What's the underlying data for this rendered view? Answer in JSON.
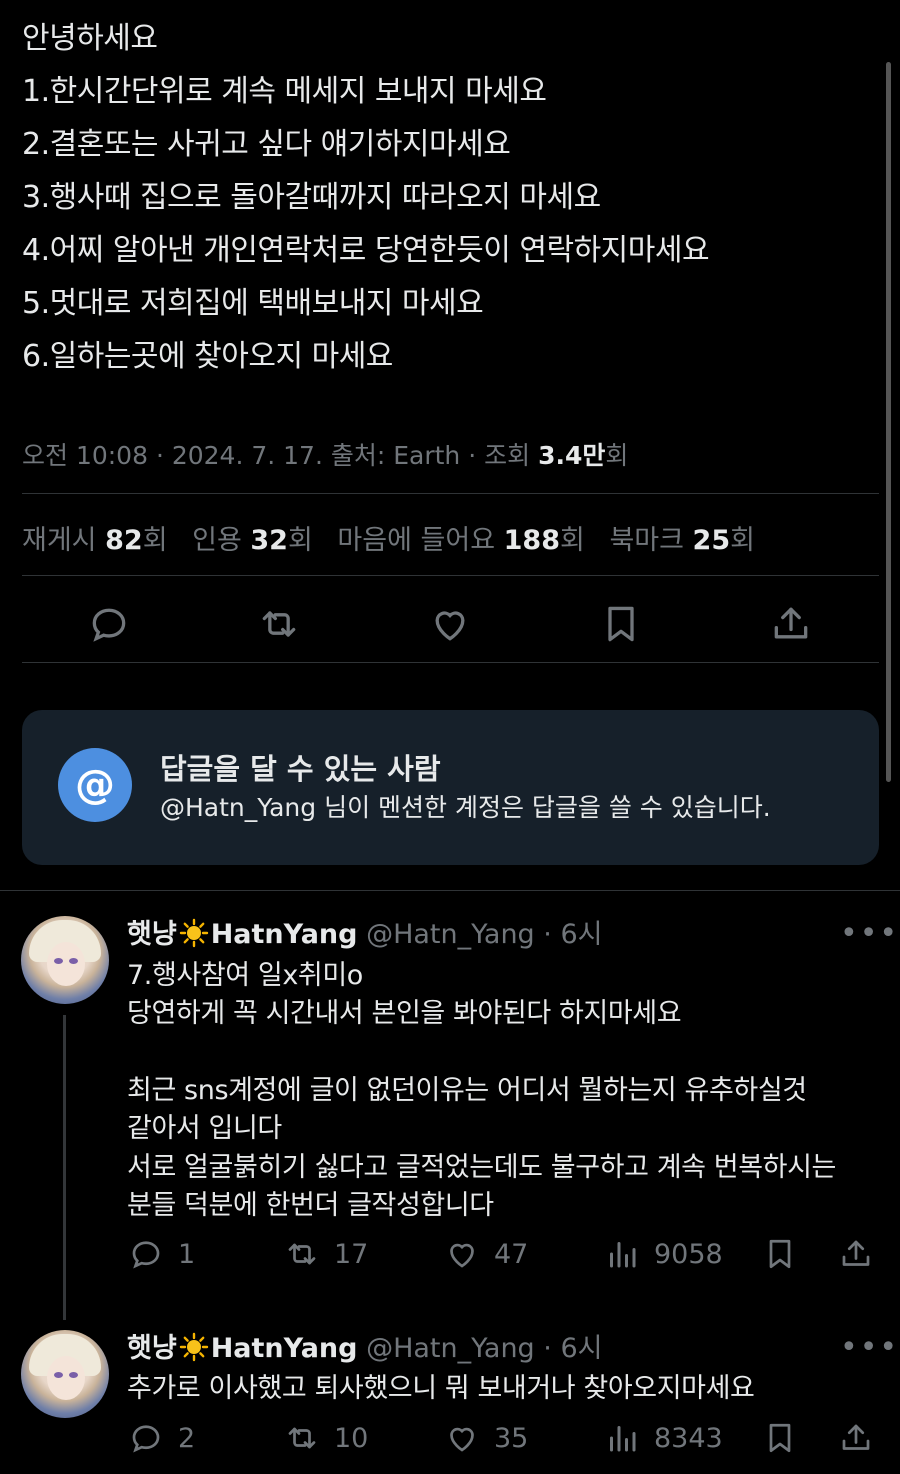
{
  "tweet": {
    "lines": [
      "안녕하세요",
      "1.한시간단위로 계속 메세지 보내지 마세요",
      "2.결혼또는 사귀고 싶다 얘기하지마세요",
      "3.행사때 집으로 돌아갈때까지 따라오지 마세요",
      "4.어찌 알아낸 개인연락처로 당연한듯이 연락하지마세요",
      "5.멋대로 저희집에 택배보내지 마세요",
      "6.일하는곳에 찾아오지 마세요"
    ],
    "meta_prefix": "오전 10:08 · 2024. 7. 17. 출처: Earth · 조회 ",
    "views_value": "3.4만",
    "views_suffix": "회",
    "stats": {
      "repost_label": "재게시 ",
      "repost_value": "82",
      "repost_unit": "회",
      "quote_label": "인용 ",
      "quote_value": "32",
      "quote_unit": "회",
      "like_label": "마음에 들어요 ",
      "like_value": "188",
      "like_unit": "회",
      "bookmark_label": "북마크 ",
      "bookmark_value": "25",
      "bookmark_unit": "회"
    },
    "actions": [
      "reply-icon",
      "repost-icon",
      "like-icon",
      "bookmark-icon",
      "share-icon"
    ]
  },
  "reply_restriction": {
    "icon": "@",
    "title": "답글을 달 수 있는 사람",
    "subtitle": "@Hatn_Yang 님이 멘션한 계정은 답글을 쓸 수 있습니다."
  },
  "replies": [
    {
      "name_prefix": "햇냥",
      "name_suffix": "HatnYang",
      "handle": "@Hatn_Yang · 6시",
      "more": "•••",
      "lines": [
        "7.행사참여 일x취미o",
        "당연하게 꼭 시간내서 본인을 봐야된다 하지마세요",
        "",
        "최근 sns계정에 글이 없던이유는 어디서 뭘하는지 유추하실것",
        "같아서 입니다",
        "서로 얼굴붉히기 싫다고 글적었는데도 불구하고 계속 번복하시는",
        "분들 덕분에 한번더 글작성합니다"
      ],
      "reply_count": "1",
      "repost_count": "17",
      "like_count": "47",
      "view_count": "9058"
    },
    {
      "name_prefix": "햇냥",
      "name_suffix": "HatnYang",
      "handle": "@Hatn_Yang · 6시",
      "more": "•••",
      "lines": [
        "추가로 이사했고 퇴사했으니 뭐 보내거나 찾아오지마세요"
      ],
      "reply_count": "2",
      "repost_count": "10",
      "like_count": "35",
      "view_count": "8343"
    }
  ],
  "colors": {
    "background": "#000000",
    "text": "#e7e9ea",
    "muted": "#71767b",
    "accent": "#4d8fe0",
    "card": "#16202a"
  }
}
